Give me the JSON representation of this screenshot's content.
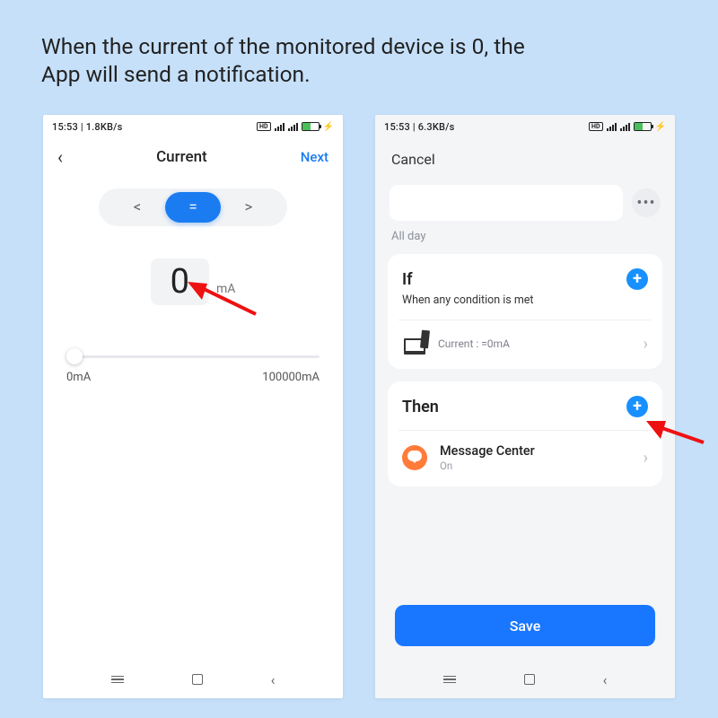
{
  "banner": {
    "line1": "When the current of the monitored device is 0, the",
    "line2": "App will send a notification."
  },
  "left": {
    "status_time": "15:53 | 1.8KB/s",
    "nav_title": "Current",
    "nav_next": "Next",
    "op_lt": "<",
    "op_eq": "=",
    "op_gt": ">",
    "value": "0",
    "unit": "mA",
    "min_label": "0mA",
    "max_label": "100000mA"
  },
  "right": {
    "status_time": "15:53 | 6.3KB/s",
    "cancel": "Cancel",
    "allday": "All day",
    "if_title": "If",
    "if_sub": "When any condition is met",
    "cond_text": "Current : =0mA",
    "then_title": "Then",
    "action_title": "Message Center",
    "action_sub": "On",
    "save": "Save"
  },
  "colors": {
    "accent": "#1b7cf2",
    "add": "#1890ff",
    "save": "#1976ff",
    "msg_icon": "#ff7b3a"
  }
}
